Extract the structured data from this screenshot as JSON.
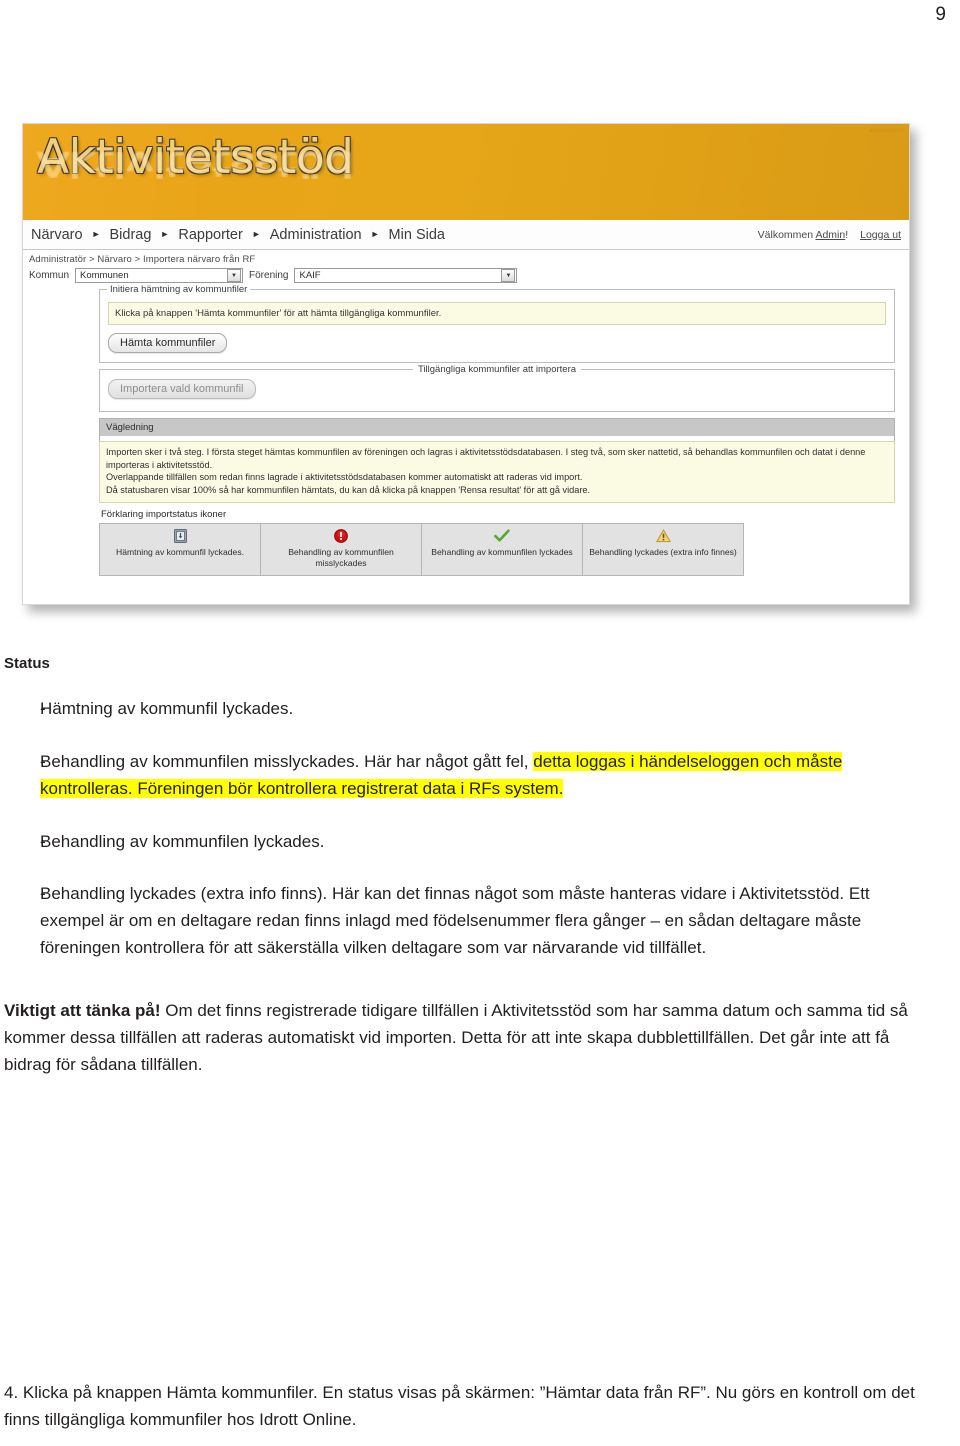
{
  "page": {
    "number": "9"
  },
  "screenshot": {
    "banner": {
      "wordmark": "Aktivitetsstöd",
      "corner_mark": "aktivitetsstöd"
    },
    "nav": {
      "items": [
        {
          "label": "Närvaro"
        },
        {
          "label": "Bidrag"
        },
        {
          "label": "Rapporter"
        },
        {
          "label": "Administration"
        },
        {
          "label": "Min Sida"
        }
      ],
      "arrow_glyph": "►",
      "welcome_prefix": "Välkommen ",
      "welcome_user": "Admin",
      "welcome_suffix": "!",
      "logout_label": "Logga ut"
    },
    "breadcrumb": "Administratör > Närvaro > Importera närvaro från RF",
    "selectors": {
      "kommun_label": "Kommun",
      "kommun_value": "Kommunen",
      "forening_label": "Förening",
      "forening_value": "KAIF",
      "dropdown_glyph": "▼"
    },
    "fetch_section": {
      "legend": "Initiera hämtning av kommunfiler",
      "info_text": "Klicka på knappen 'Hämta kommunfiler' för att hämta tillgängliga kommunfiler.",
      "button_label": "Hämta kommunfiler"
    },
    "import_section": {
      "legend": "Tillgängliga kommunfiler att importera",
      "button_label": "Importera vald kommunfil"
    },
    "guide": {
      "header": "Vägledning",
      "lines": [
        "Importen sker i två steg. I första steget hämtas kommunfilen av föreningen och lagras i aktivitetsstödsdatabasen. I steg två, som sker nattetid, så behandlas kommunfilen och datat i denne importeras i aktivitetsstöd.",
        "Overlappande tillfällen som redan finns lagrade i aktivitetsstödsdatabasen kommer automatiskt att raderas vid import.",
        "Då statusbaren visar 100% så har kommunfilen hämtats, du kan då klicka på knappen 'Rensa resultat' för att gå vidare."
      ]
    },
    "icon_legend": {
      "title": "Förklaring importstatus ikoner",
      "cells": [
        {
          "icon": "download-file-icon",
          "caption": "Hämtning av kommunfil lyckades."
        },
        {
          "icon": "error-circle-icon",
          "caption": "Behandling av kommunfilen misslyckades"
        },
        {
          "icon": "check-mark-icon",
          "caption": "Behandling av kommunfilen lyckades"
        },
        {
          "icon": "warning-triangle-icon",
          "caption": "Behandling lyckades (extra info finnes)"
        }
      ]
    }
  },
  "document": {
    "heading": "Status",
    "bullets": [
      {
        "dash": "-",
        "segments": [
          {
            "text": "Hämtning av kommunfil lyckades.",
            "highlight": false
          }
        ]
      },
      {
        "dash": "-",
        "segments": [
          {
            "text": "Behandling av kommunfilen misslyckades.\nHär har något gått fel, ",
            "highlight": false
          },
          {
            "text": "detta loggas i händelseloggen och måste kontrolleras.\nFöreningen bör kontrollera registrerat data i RFs system.",
            "highlight": true
          }
        ]
      },
      {
        "dash": "-",
        "segments": [
          {
            "text": "Behandling av kommunfilen lyckades.",
            "highlight": false
          }
        ]
      },
      {
        "dash": "-",
        "segments": [
          {
            "text": "Behandling lyckades (extra info finns).\nHär kan det finnas något som måste hanteras vidare i Aktivitetsstöd. Ett exempel är om en deltagare redan finns inlagd med födelsenummer flera gånger – en sådan deltagare måste föreningen kontrollera för att säkerställa vilken deltagare som var närvarande vid tillfället.",
            "highlight": false
          }
        ]
      }
    ],
    "important": {
      "lead": "Viktigt att tänka på!",
      "body": " Om det finns registrerade tidigare tillfällen i Aktivitetsstöd som har samma datum och samma tid så kommer dessa tillfällen att raderas automatiskt vid importen. Detta för att inte skapa dubblettillfällen. Det går inte att få bidrag för sådana tillfällen."
    },
    "footer_step": "4. Klicka på knappen Hämta kommunfiler. En status visas på skärmen: ”Hämtar data från RF”. Nu görs en kontroll om det finns tillgängliga kommunfiler hos Idrott Online."
  },
  "colors": {
    "banner_orange": "#e6a618",
    "highlight_yellow": "#ffff00",
    "info_panel": "#fbfbe4",
    "error_red": "#cc1111",
    "success_green": "#5aa832",
    "warning_amber": "#e8c14a"
  }
}
